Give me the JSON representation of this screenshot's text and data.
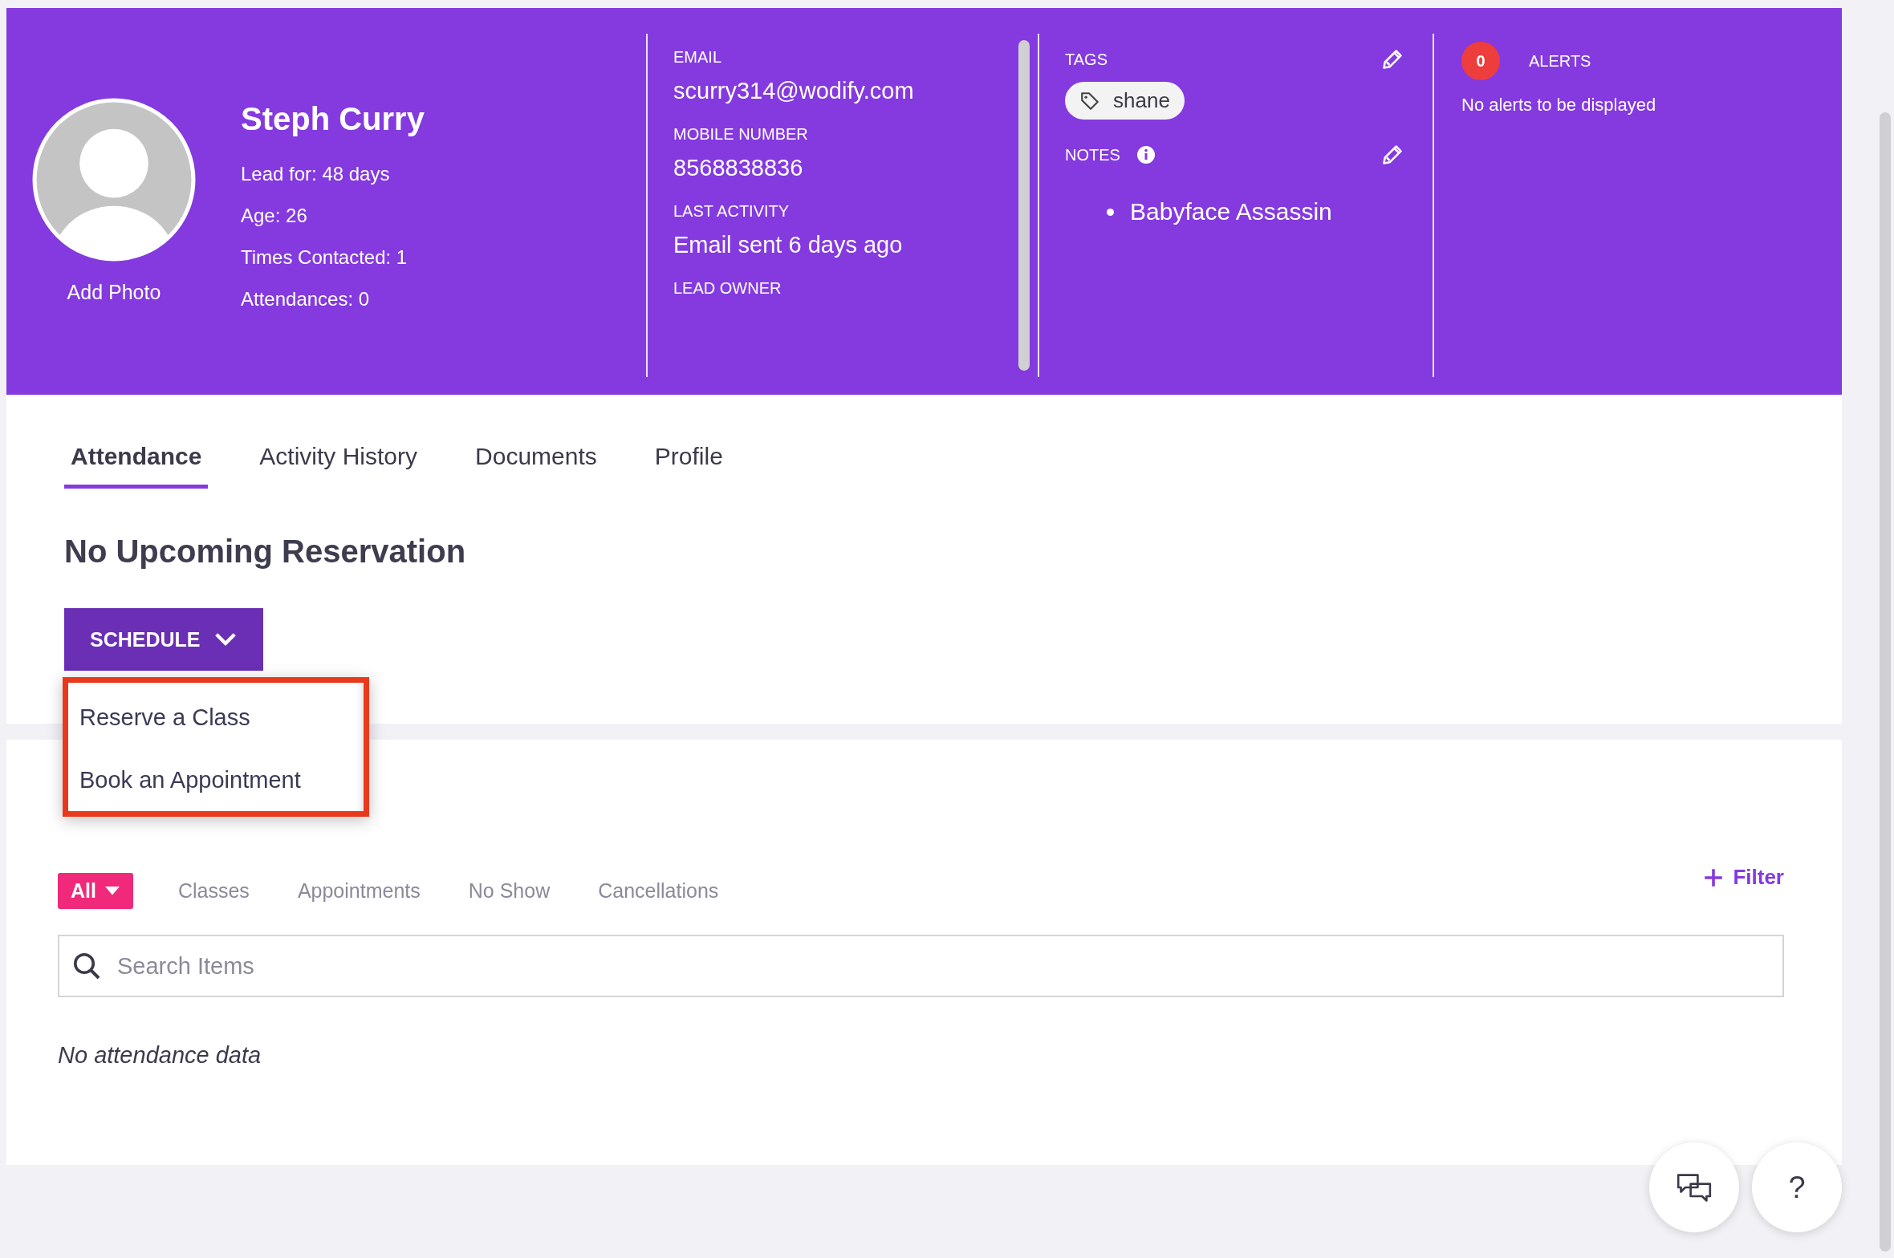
{
  "profile": {
    "avatar_caption": "Add Photo",
    "name": "Steph Curry",
    "details": [
      "Lead for: 48 days",
      "Age: 26",
      "Times Contacted: 1",
      "Attendances: 0"
    ]
  },
  "contact": [
    {
      "label": "EMAIL",
      "value": "scurry314@wodify.com"
    },
    {
      "label": "MOBILE NUMBER",
      "value": "8568838836"
    },
    {
      "label": "LAST ACTIVITY",
      "value": "Email sent 6 days ago"
    },
    {
      "label": "LEAD OWNER"
    }
  ],
  "tags": {
    "label": "TAGS",
    "items": [
      "shane"
    ]
  },
  "notes": {
    "label": "NOTES",
    "items": [
      "Babyface Assassin"
    ]
  },
  "alerts": {
    "count": "0",
    "label": "ALERTS",
    "message": "No alerts to be displayed"
  },
  "tabs": [
    {
      "label": "Attendance",
      "selected": true
    },
    {
      "label": "Activity History",
      "selected": false
    },
    {
      "label": "Documents",
      "selected": false
    },
    {
      "label": "Profile",
      "selected": false
    }
  ],
  "reservation": {
    "title": "No Upcoming Reservation"
  },
  "schedule_button": {
    "label": "SCHEDULE",
    "expanded": true,
    "menu": [
      "Reserve a Class",
      "Book an Appointment"
    ]
  },
  "attendances": {
    "filters": [
      {
        "label": "All",
        "selected": true
      },
      {
        "label": "Classes",
        "selected": false
      },
      {
        "label": "Appointments",
        "selected": false
      },
      {
        "label": "No Show",
        "selected": false
      },
      {
        "label": "Cancellations",
        "selected": false
      }
    ],
    "filter_button": "Filter",
    "search": {
      "placeholder": "Search Items"
    },
    "empty_message": "No attendance data"
  },
  "help_button": "?"
}
